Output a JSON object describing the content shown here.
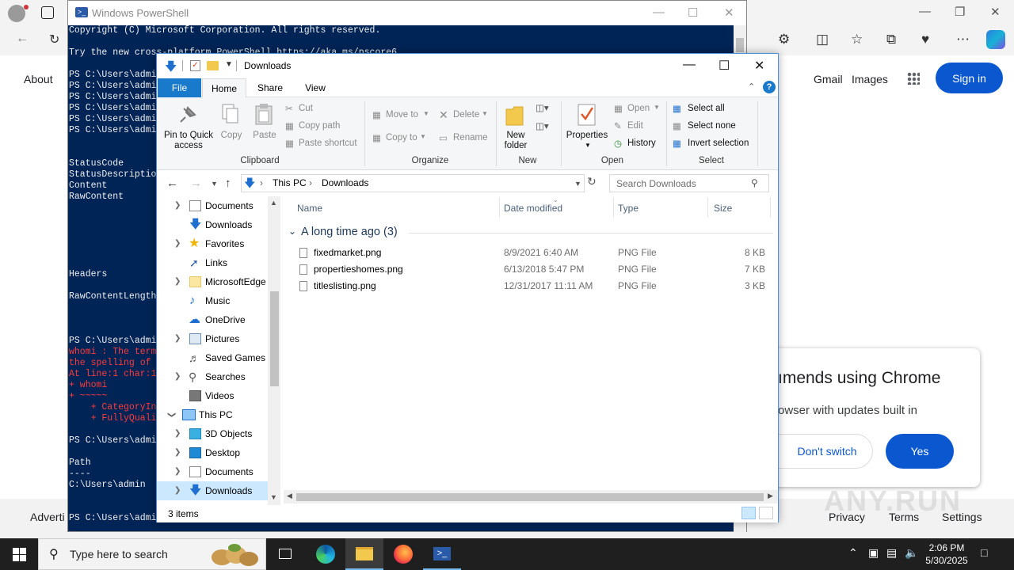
{
  "browser": {
    "google": {
      "about": "About",
      "gmail": "Gmail",
      "images": "Images",
      "sign_in": "Sign in",
      "footer": {
        "advertising": "Adverti",
        "privacy": "Privacy",
        "terms": "Terms",
        "settings": "Settings"
      }
    },
    "chrome_popup": {
      "title": "ımends using Chrome",
      "text": "owser with updates built in",
      "dont_switch": "Don't switch",
      "yes": "Yes"
    },
    "watermark": "ANY.RUN"
  },
  "powershell": {
    "title": "Windows PowerShell",
    "lines": [
      "Copyright (C) Microsoft Corporation. All rights reserved.",
      "Try the new cross-platform PowerShell https://aka.ms/pscore6",
      "PS C:\\Users\\admi",
      "PS C:\\Users\\admi",
      "PS C:\\Users\\admi",
      "PS C:\\Users\\admi",
      "PS C:\\Users\\admi",
      "PS C:\\Users\\admi",
      "StatusCode",
      "StatusDescriptio",
      "Content",
      "RawContent",
      "Headers",
      "RawContentLength",
      "PS C:\\Users\\admi",
      "whomi : The term",
      "the spelling of",
      "At line:1 char:1",
      "+ whomi",
      "+ ~~~~~",
      "    + CategoryIn",
      "    + FullyQuali",
      "PS C:\\Users\\admi",
      "Path",
      "----",
      "C:\\Users\\admin",
      "PS C:\\Users\\admi"
    ]
  },
  "explorer": {
    "title": "Downloads",
    "tabs": {
      "file": "File",
      "home": "Home",
      "share": "Share",
      "view": "View"
    },
    "ribbon": {
      "pin": "Pin to Quick access",
      "copy": "Copy",
      "paste": "Paste",
      "cut": "Cut",
      "copy_path": "Copy path",
      "paste_shortcut": "Paste shortcut",
      "clipboard": "Clipboard",
      "move_to": "Move to",
      "copy_to": "Copy to",
      "delete": "Delete",
      "rename": "Rename",
      "organize": "Organize",
      "new_folder": "New folder",
      "new": "New",
      "properties": "Properties",
      "open": "Open",
      "edit": "Edit",
      "history": "History",
      "open_group": "Open",
      "select_all": "Select all",
      "select_none": "Select none",
      "invert_selection": "Invert selection",
      "select": "Select"
    },
    "address": {
      "this_pc": "This PC",
      "downloads": "Downloads"
    },
    "search_placeholder": "Search Downloads",
    "nav": [
      {
        "label": "Documents",
        "icon": "document-icon",
        "chevron": true
      },
      {
        "label": "Downloads",
        "icon": "download-icon",
        "chevron": false
      },
      {
        "label": "Favorites",
        "icon": "star-icon",
        "chevron": true
      },
      {
        "label": "Links",
        "icon": "link-icon",
        "chevron": false
      },
      {
        "label": "MicrosoftEdge",
        "icon": "folder-icon",
        "chevron": true
      },
      {
        "label": "Music",
        "icon": "music-icon",
        "chevron": false
      },
      {
        "label": "OneDrive",
        "icon": "onedrive-icon",
        "chevron": false
      },
      {
        "label": "Pictures",
        "icon": "pictures-icon",
        "chevron": true
      },
      {
        "label": "Saved Games",
        "icon": "saved-games-icon",
        "chevron": false
      },
      {
        "label": "Searches",
        "icon": "searches-icon",
        "chevron": true
      },
      {
        "label": "Videos",
        "icon": "videos-icon",
        "chevron": false
      },
      {
        "label": "This PC",
        "icon": "pc-icon",
        "chevron": true
      },
      {
        "label": "3D Objects",
        "icon": "3d-objects-icon",
        "chevron": true
      },
      {
        "label": "Desktop",
        "icon": "desktop-icon",
        "chevron": true
      },
      {
        "label": "Documents",
        "icon": "document-icon",
        "chevron": true
      },
      {
        "label": "Downloads",
        "icon": "download-icon",
        "chevron": true
      }
    ],
    "columns": {
      "name": "Name",
      "date": "Date modified",
      "type": "Type",
      "size": "Size"
    },
    "group": "A long time ago (3)",
    "files": [
      {
        "name": "fixedmarket.png",
        "date": "8/9/2021 6:40 AM",
        "type": "PNG File",
        "size": "8 KB"
      },
      {
        "name": "propertieshomes.png",
        "date": "6/13/2018 5:47 PM",
        "type": "PNG File",
        "size": "7 KB"
      },
      {
        "name": "titleslisting.png",
        "date": "12/31/2017 11:11 AM",
        "type": "PNG File",
        "size": "3 KB"
      }
    ],
    "status": "3 items"
  },
  "taskbar": {
    "search_placeholder": "Type here to search",
    "time": "2:06 PM",
    "date": "5/30/2025"
  },
  "colors": {
    "powershell_bg": "#012456",
    "explorer_accent": "#1979ca",
    "google_blue": "#0b57d0"
  }
}
